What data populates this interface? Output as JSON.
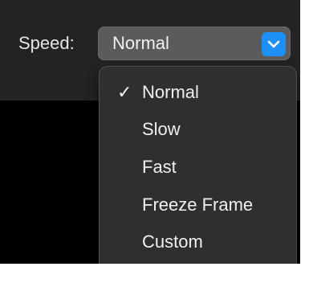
{
  "speed_control": {
    "label": "Speed:",
    "selected_value": "Normal",
    "arrow_icon": "chevron-down-icon",
    "accent_color": "#1e8ff5"
  },
  "menu": {
    "checkmark": "✓",
    "items": [
      {
        "label": "Normal",
        "checked": true
      },
      {
        "label": "Slow",
        "checked": false
      },
      {
        "label": "Fast",
        "checked": false
      },
      {
        "label": "Freeze Frame",
        "checked": false
      },
      {
        "label": "Custom",
        "checked": false
      }
    ]
  }
}
